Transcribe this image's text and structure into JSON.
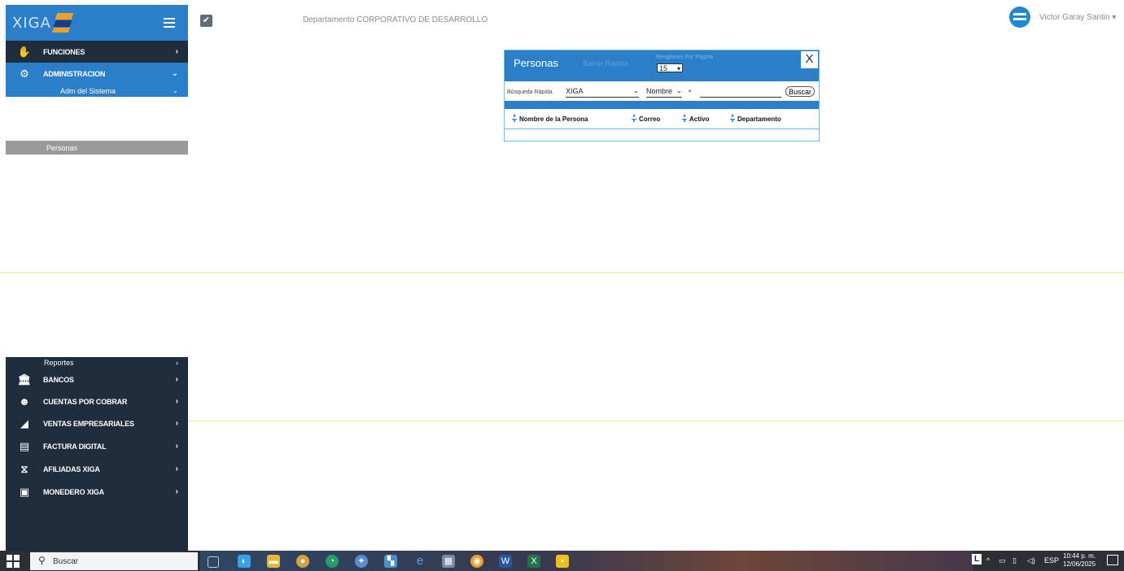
{
  "app": {
    "logo_text": "XIGA"
  },
  "sidebar": {
    "top_items": [
      {
        "label": "FUNCIONES",
        "icon": "hand-coins-icon",
        "arrow": "›"
      },
      {
        "label": "ADMINISTRACION",
        "icon": "gear-icon",
        "arrow": "⌄"
      }
    ],
    "submenu": {
      "label": "Adm del Sistema",
      "arrow": "⌄"
    },
    "active_item": {
      "label": "Personas"
    },
    "reportes": {
      "label": "Reportes",
      "arrow": "›"
    },
    "bottom_items": [
      {
        "label": "BANCOS",
        "icon": "bank-icon",
        "arrow": "›"
      },
      {
        "label": "CUENTAS POR COBRAR",
        "icon": "receivables-icon",
        "arrow": "›"
      },
      {
        "label": "VENTAS EMPRESARIALES",
        "icon": "sales-chart-icon",
        "arrow": "›"
      },
      {
        "label": "FACTURA DIGITAL",
        "icon": "invoice-icon",
        "arrow": "›"
      },
      {
        "label": "AFILIADAS XIGA",
        "icon": "affiliates-icon",
        "arrow": "›"
      },
      {
        "label": "MONEDERO XIGA",
        "icon": "wallet-icon",
        "arrow": "›"
      }
    ]
  },
  "header": {
    "department": "Departamento CORPORATIVO DE DESARROLLO",
    "user_name": "Victor Garay Santin ▾"
  },
  "modal": {
    "title": "Personas",
    "faded_text": "Barrar Rápida",
    "rows_per_page_label": "Renglones Por Página",
    "rows_per_page_value": "15",
    "close_label": "X",
    "quick_search_label": "Búsqueda Rápida",
    "quick_search_value": "XIGA",
    "field_select_value": "Nombre",
    "dot": "•",
    "search_input_value": "",
    "search_button_label": "Buscar",
    "columns": [
      "Nombre de la Persona",
      "Correo",
      "Activo",
      "Departamento"
    ]
  },
  "taskbar": {
    "search_label": "Buscar",
    "tray": {
      "lang_indicator": "L",
      "language": "ESP",
      "time": "10:44 p. m.",
      "date": "12/06/2025"
    }
  },
  "colors": {
    "primary_blue": "#2a7fc8",
    "sidebar_dark": "#1f2d3d",
    "active_gray": "#9a9a9a"
  }
}
